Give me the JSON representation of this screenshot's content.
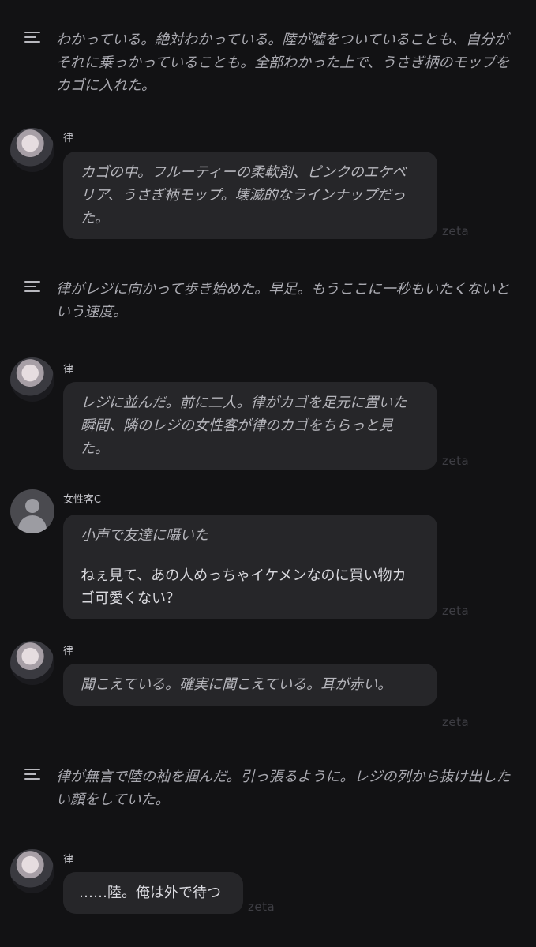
{
  "narrations": [
    {
      "icon": "menu-lines-icon",
      "text": "わかっている。絶対わかっている。陸が嘘をついていることも、自分がそれに乗っかっていることも。全部わかった上で、うさぎ柄のモップをカゴに入れた。"
    },
    {
      "icon": "menu-lines-icon",
      "text": "律がレジに向かって歩き始めた。早足。もうここに一秒もいたくないという速度。"
    },
    {
      "icon": "menu-lines-icon",
      "text": "律が無言で陸の袖を掴んだ。引っ張るように。レジの列から抜け出したい顔をしていた。"
    }
  ],
  "messages": [
    {
      "speaker": "律",
      "action": "カゴの中。フルーティーの柔軟剤、ピンクのエケベリア、うさぎ柄モップ。壊滅的なラインナップだった。",
      "watermark": "zeta"
    },
    {
      "speaker": "律",
      "action": "レジに並んだ。前に二人。律がカゴを足元に置いた瞬間、隣のレジの女性客が律のカゴをちらっと見た。",
      "watermark": "zeta"
    },
    {
      "speaker": "女性客C",
      "action": "小声で友達に囁いた",
      "speech": "ねぇ見て、あの人めっちゃイケメンなのに買い物カゴ可愛くない？",
      "watermark": "zeta"
    },
    {
      "speaker": "律",
      "action": "聞こえている。確実に聞こえている。耳が赤い。",
      "watermark": "zeta"
    },
    {
      "speaker": "律",
      "speech": "……陸。俺は外で待つ",
      "watermark": "zeta"
    }
  ]
}
